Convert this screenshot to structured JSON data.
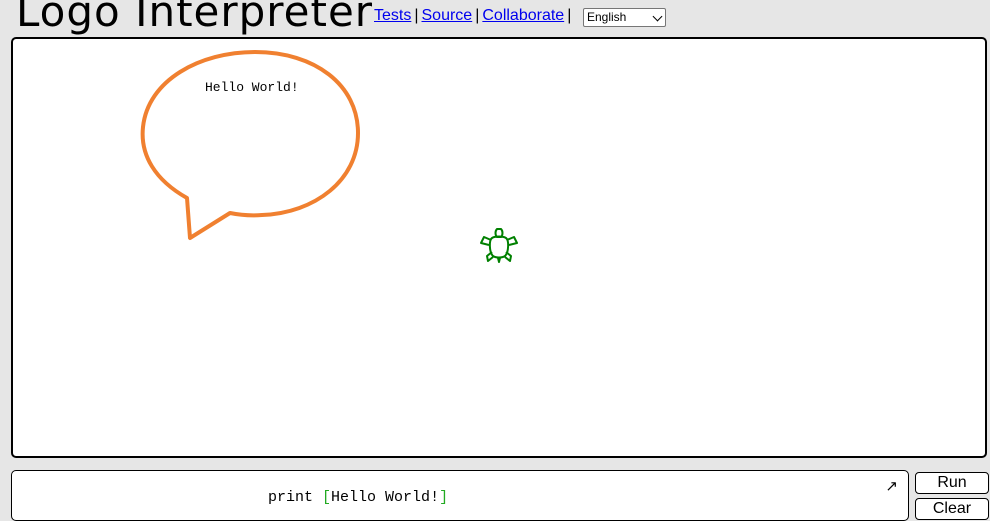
{
  "header": {
    "title": "Logo Interpreter",
    "links": [
      "Tests",
      "Source",
      "Collaborate"
    ],
    "separator": "|",
    "language_selected": "English"
  },
  "canvas": {
    "speech_bubble_text": "Hello World!",
    "turtle_color": "#008000",
    "annotation_color": "#f08030"
  },
  "editor": {
    "code_keyword": "print",
    "code_open_bracket": "[",
    "code_content": "Hello World!",
    "code_close_bracket": "]",
    "expand_icon": "↗"
  },
  "buttons": {
    "run_label": "Run",
    "clear_label": "Clear"
  }
}
